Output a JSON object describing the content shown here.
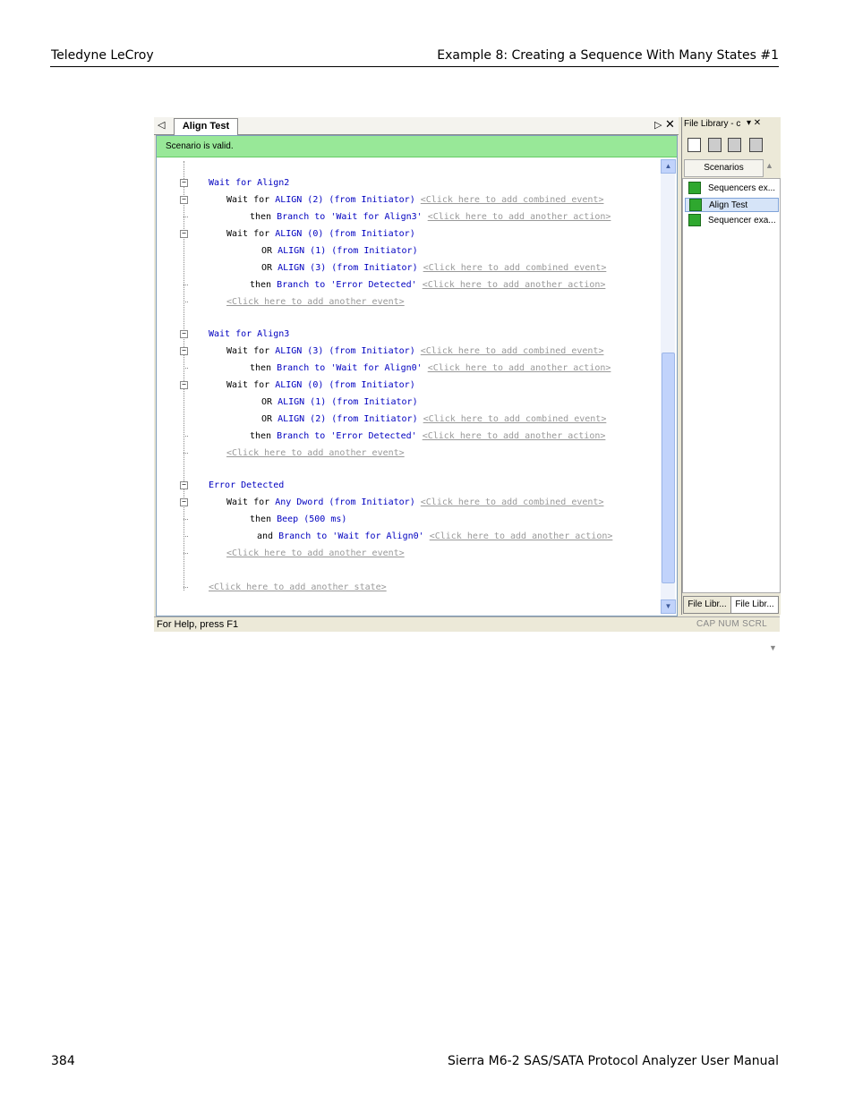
{
  "page": {
    "header_left": "Teledyne LeCroy",
    "header_right": "Example 8: Creating a Sequence With Many States #1",
    "footer_left": "384",
    "footer_right": "Sierra M6-2 SAS/SATA Protocol Analyzer User Manual"
  },
  "window": {
    "tab_label": "Align Test",
    "validity": "Scenario is valid.",
    "status_help": "For Help, press F1",
    "status_keys": "CAP  NUM  SCRL"
  },
  "code": {
    "state1": "Wait for Align2",
    "s1_e1": "Wait for ",
    "s1_e1_cond": "ALIGN (2) (from Initiator)",
    "combined": "<Click here to add combined event>",
    "s1_a1_then": "then ",
    "s1_a1": "Branch to 'Wait for Align3'",
    "another_action": "<Click here to add another action>",
    "s1_e2_cond": "ALIGN (0) (from Initiator)",
    "or": "OR ",
    "s1_e2_or1": "ALIGN (1) (from Initiator)",
    "s1_e2_or2": "ALIGN (3) (from Initiator)",
    "branch_err": "Branch to 'Error Detected'",
    "another_event": "<Click here to add another event>",
    "state2": "Wait for Align3",
    "s2_e1_cond": "ALIGN (3) (from Initiator)",
    "branch_align0": "Branch to 'Wait for Align0'",
    "s2_e2_cond": "ALIGN (0) (from Initiator)",
    "s2_e2_or1": "ALIGN (1) (from Initiator)",
    "s2_e2_or2": "ALIGN (2) (from Initiator)",
    "state3": "Error Detected",
    "s3_e1_cond": "Any Dword (from Initiator)",
    "beep": "Beep (500 ms)",
    "and": "and ",
    "another_state": "<Click here to add another state>"
  },
  "panel": {
    "title": "File Library - c",
    "controls": "▾ ✕",
    "scenarios_tab": "Scenarios",
    "items": [
      "Sequencers ex...",
      "Align Test",
      "Sequencer exa..."
    ],
    "bottom_tabs": [
      "File Libr...",
      "File Libr..."
    ]
  }
}
